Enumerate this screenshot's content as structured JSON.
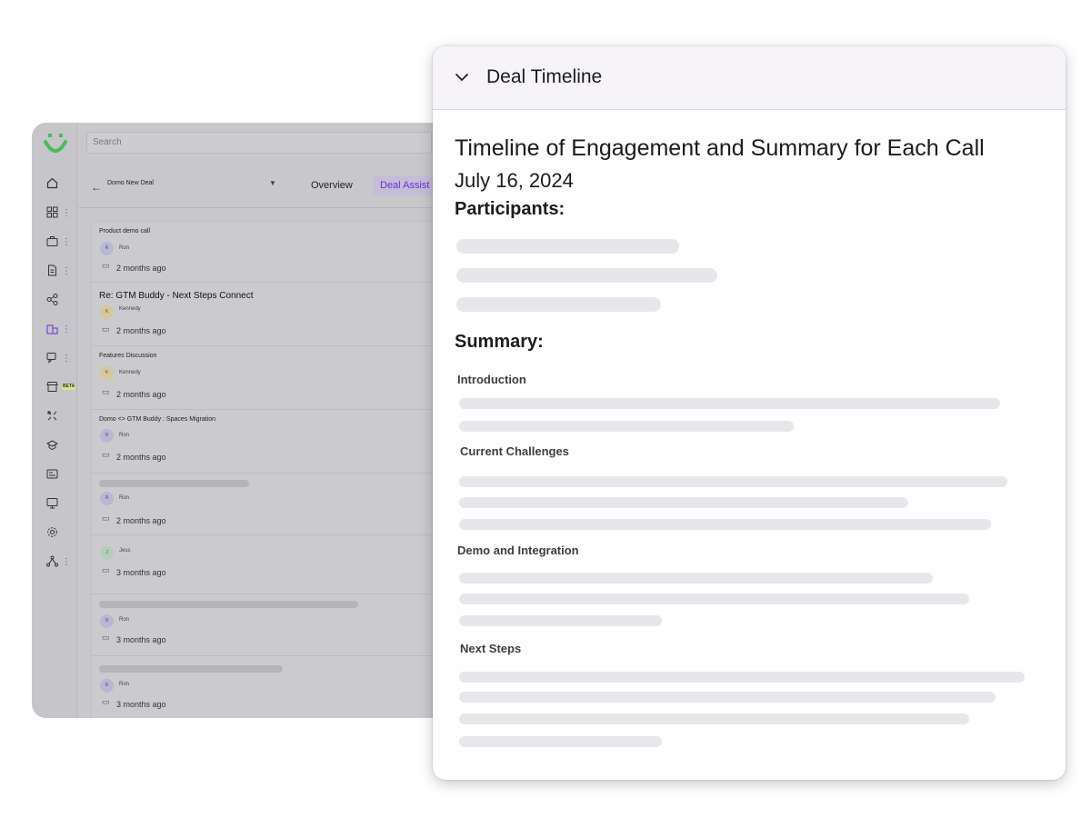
{
  "app": {
    "search_placeholder": "Search",
    "deal_name": "Domo New Deal",
    "tabs": {
      "overview": "Overview",
      "deal_assist": "Deal Assist"
    },
    "beta_badge": "BETA",
    "calls": [
      {
        "title": "Product demo call",
        "person": "Ron",
        "initial": "R",
        "date": "2 months ago"
      },
      {
        "title": "Re: GTM Buddy - Next Steps Connect",
        "person": "Kennedy",
        "initial": "K",
        "date": "2 months ago"
      },
      {
        "title": "Features Discussion",
        "person": "Kennedy",
        "initial": "K",
        "date": "2 months ago"
      },
      {
        "title": "Domo <> GTM Buddy : Spaces Migration",
        "person": "Ron",
        "initial": "R",
        "date": "2 months ago"
      },
      {
        "title": "",
        "person": "Ron",
        "initial": "R",
        "date": "2 months ago"
      },
      {
        "title": "",
        "person": "Jess",
        "initial": "J",
        "date": "3 months ago"
      },
      {
        "title": "",
        "person": "Ron",
        "initial": "R",
        "date": "3 months ago"
      },
      {
        "title": "",
        "person": "Ron",
        "initial": "R",
        "date": "3 months ago"
      }
    ],
    "colors": {
      "accent": "#6b2fd1",
      "logo": "#4cbb5a"
    }
  },
  "panel": {
    "header_title": "Deal Timeline",
    "heading": "Timeline of Engagement and Summary for Each Call",
    "date": "July 16, 2024",
    "participants_label": "Participants:",
    "summary_label": "Summary:",
    "sections": {
      "introduction": "Introduction",
      "current_challenges": "Current Challenges",
      "demo_integration": "Demo and Integration",
      "next_steps": "Next Steps"
    }
  }
}
